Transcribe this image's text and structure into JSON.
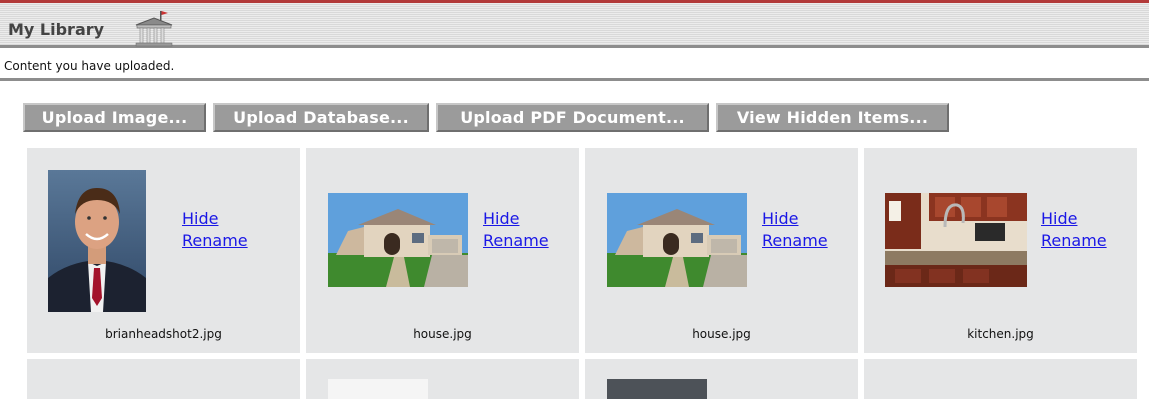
{
  "header": {
    "title": "My Library",
    "icon": "library-building-icon"
  },
  "subtitle": "Content you have uploaded.",
  "toolbar": {
    "upload_image": "Upload Image...",
    "upload_database": "Upload Database...",
    "upload_pdf": "Upload PDF Document...",
    "view_hidden": "View Hidden Items..."
  },
  "items": [
    {
      "filename": "brianheadshot2.jpg",
      "hide": "Hide",
      "rename": "Rename",
      "thumb": "portrait-photo"
    },
    {
      "filename": "house.jpg",
      "hide": "Hide",
      "rename": "Rename",
      "thumb": "house-photo"
    },
    {
      "filename": "house.jpg",
      "hide": "Hide",
      "rename": "Rename",
      "thumb": "house-photo"
    },
    {
      "filename": "kitchen.jpg",
      "hide": "Hide",
      "rename": "Rename",
      "thumb": "kitchen-photo"
    }
  ],
  "colors": {
    "link": "#1a17e6",
    "cell_bg": "#e5e6e7",
    "button_bg": "#9b9b9b",
    "header_accent": "#b23a3a"
  }
}
